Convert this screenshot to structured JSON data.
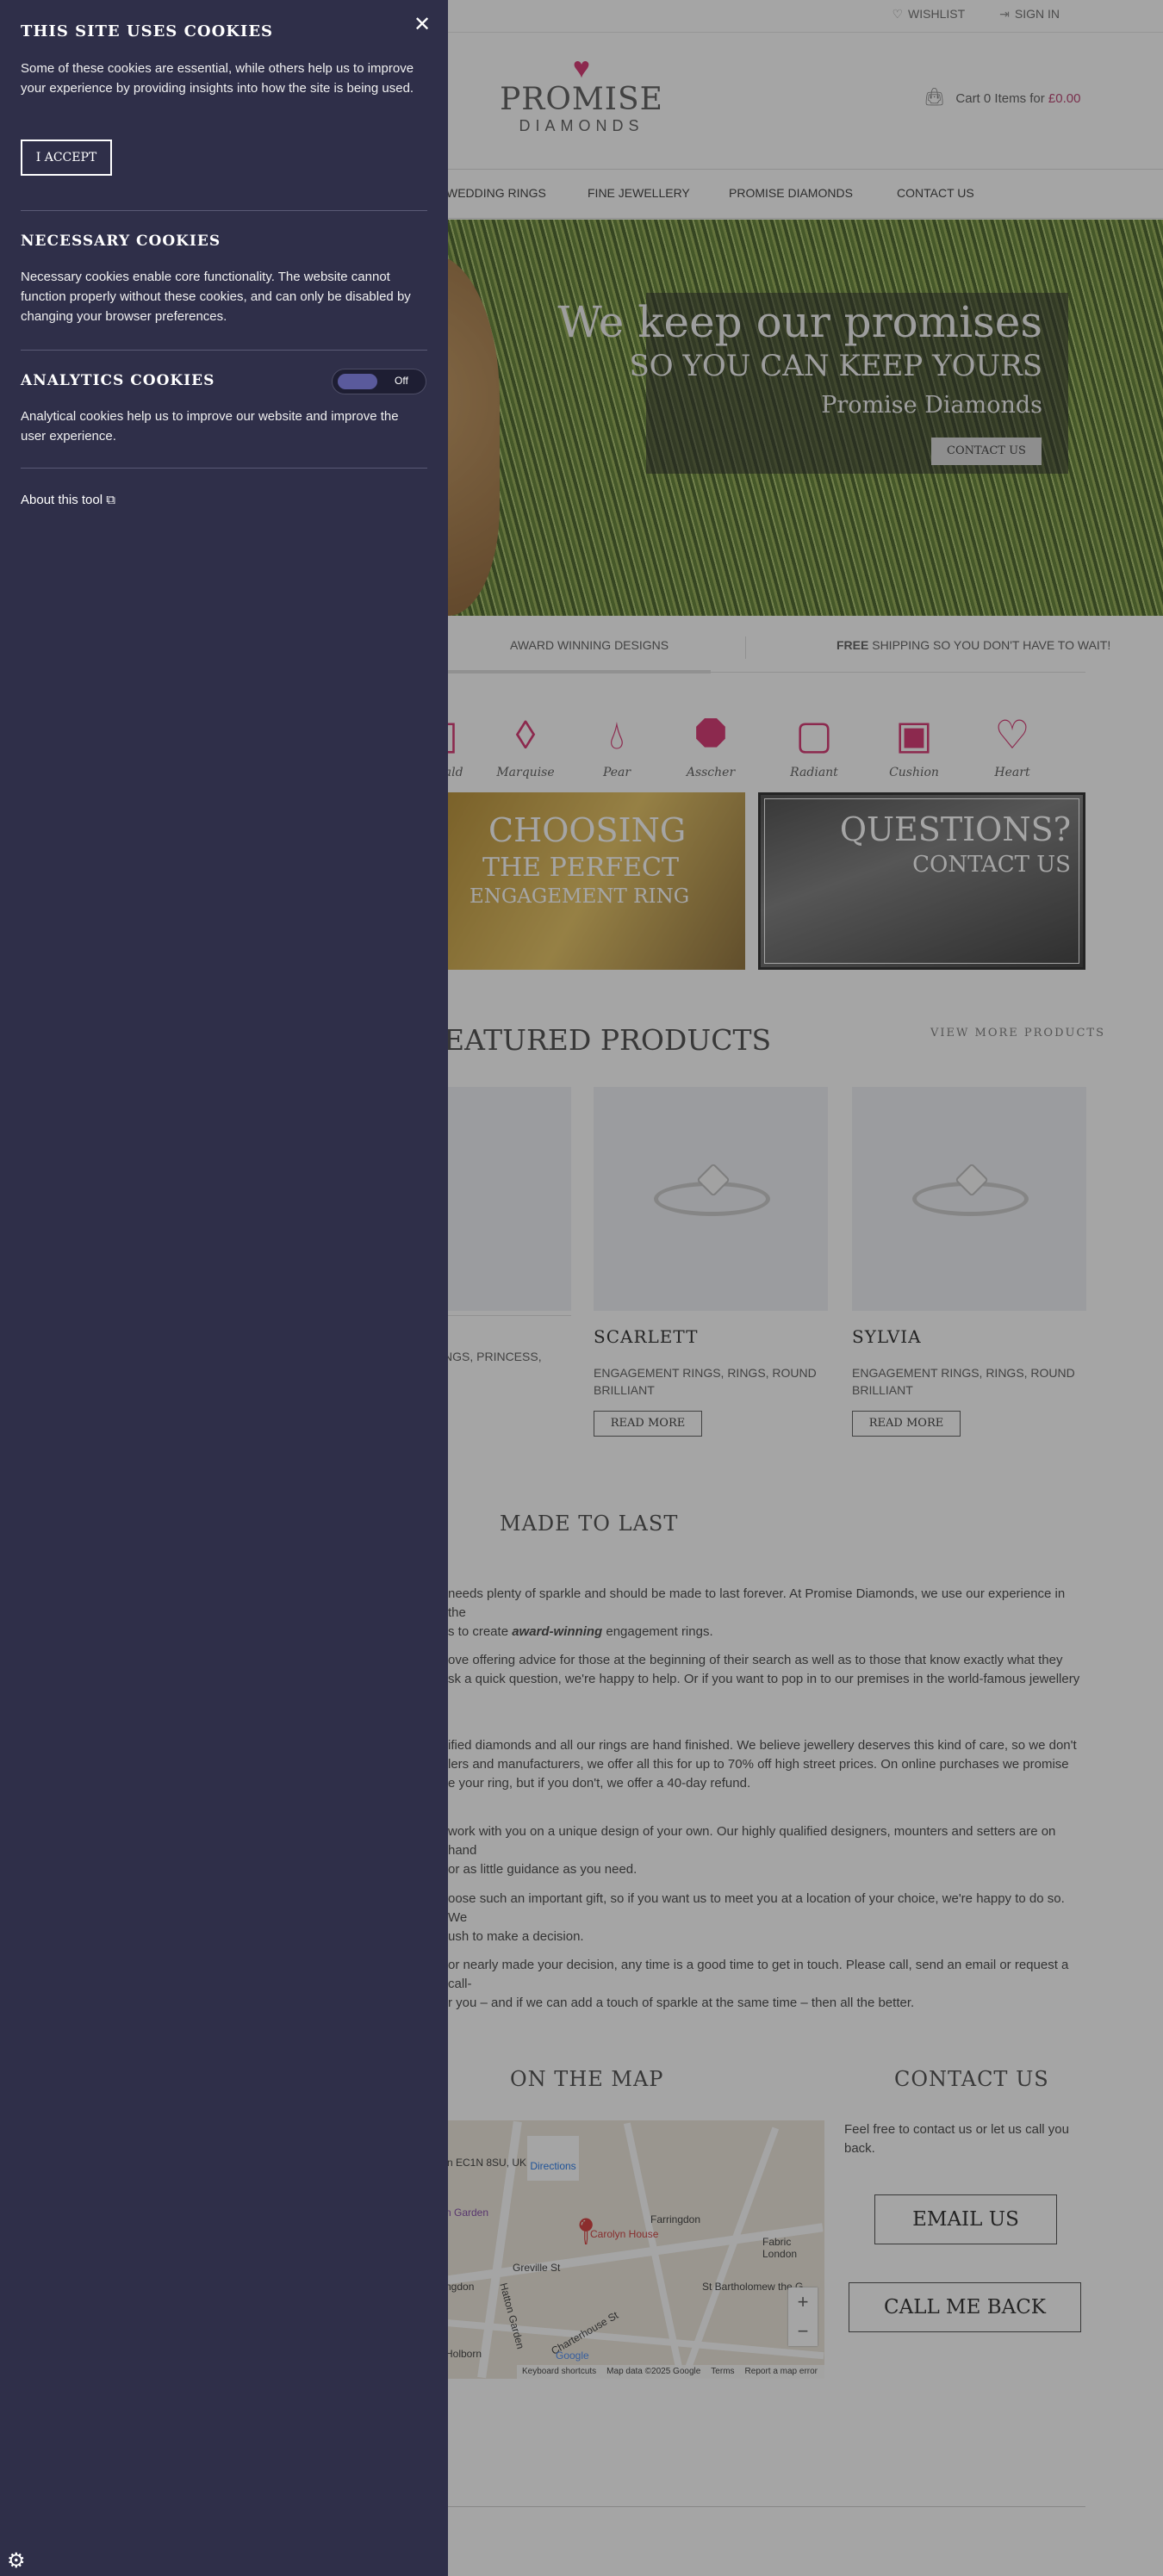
{
  "topbar": {
    "wishlist": "WISHLIST",
    "signin": "SIGN IN"
  },
  "logo": {
    "name": "PROMISE",
    "sub": "DIAMONDS"
  },
  "cart": {
    "prefix": "Cart 0 Items for ",
    "amount": "£0.00"
  },
  "nav": [
    "WEDDING RINGS",
    "FINE JEWELLERY",
    "PROMISE DIAMONDS",
    "CONTACT US"
  ],
  "hero": {
    "line1": "We keep our promises",
    "line2": "SO YOU CAN KEEP YOURS",
    "line3": "Promise Diamonds",
    "button": "CONTACT US"
  },
  "usp": {
    "award": "AWARD WINNING DESIGNS",
    "free_bold": "FREE",
    "free_rest": " SHIPPING SO YOU DON'T HAVE TO WAIT!"
  },
  "shapes": [
    "...ald",
    "Marquise",
    "Pear",
    "Asscher",
    "Radiant",
    "Cushion",
    "Heart"
  ],
  "promo": {
    "choose_a": "CHOOSING",
    "choose_b": "THE PERFECT",
    "choose_c": "ENGAGEMENT RING",
    "q_a": "QUESTIONS?",
    "q_b": "CONTACT US"
  },
  "featured": {
    "title": "EATURED PRODUCTS",
    "view_more": "VIEW MORE PRODUCTS",
    "partial_cats": "NGS, PRINCESS,",
    "products": [
      {
        "name": "SCARLETT",
        "cats": "ENGAGEMENT RINGS, RINGS, ROUND BRILLIANT",
        "button": "READ MORE"
      },
      {
        "name": "SYLVIA",
        "cats": "ENGAGEMENT RINGS, RINGS, ROUND BRILLIANT",
        "button": "READ MORE"
      }
    ]
  },
  "made_to_last": {
    "title": "MADE TO LAST",
    "p1a": "needs plenty of sparkle and should be made to last forever. At Promise Diamonds, we use our experience in the",
    "p1b": "s to create ",
    "p1em": "award-winning",
    "p1c": " engagement rings.",
    "p2": "ove offering advice for those at the beginning of their search as well as to those that know exactly what they\nsk a quick question, we're happy to help. Or if you want to pop in to our premises in the world-famous jewellery",
    "p3": "ified diamonds and all our rings are hand finished. We believe jewellery deserves this kind of care, so we don't\nlers and manufacturers, we offer all this for up to 70% off high street prices. On online purchases we promise\ne your ring, but if you don't, we offer a 40-day refund.",
    "p4": " work with you on a unique design of your own. Our highly qualified designers, mounters and setters are on hand\nor as little guidance as you need.",
    "p5": "oose such an important gift, so if you want us to meet you at a location of your choice, we're happy to do so. We\nush to make a decision.",
    "p6": "or nearly made your decision, any time is a good time to get in touch. Please call, send an email or request a call-\nr you – and if we can add a touch of sparkle at the same time – then all the better."
  },
  "map": {
    "title": "ON THE MAP",
    "address": "n EC1N 8SU, UK",
    "directions": "Directions",
    "labels": [
      "Carolyn House",
      "Farringdon",
      "Fabric London",
      "Greville St",
      "St Bartholomew the G",
      "n Garden",
      "ngdon",
      "Hatton Garden",
      "Holborn",
      "Charterhouse St",
      "Google"
    ],
    "footer": [
      "Keyboard shortcuts",
      "Map data ©2025 Google",
      "Terms",
      "Report a map error"
    ]
  },
  "contact": {
    "title": "CONTACT US",
    "text": "Feel free to contact us or let us call you back.",
    "email": "EMAIL US",
    "call": "CALL ME BACK"
  },
  "cookies": {
    "title": "THIS SITE USES COOKIES",
    "intro": "Some of these cookies are essential, while others help us to improve your experience by providing insights into how the site is being used.",
    "accept": "I ACCEPT",
    "necessary_title": "NECESSARY COOKIES",
    "necessary_text": "Necessary cookies enable core functionality. The website cannot function properly without these cookies, and can only be disabled by changing your browser preferences.",
    "analytics_title": "ANALYTICS COOKIES",
    "analytics_toggle": "Off",
    "analytics_text": "Analytical cookies help us to improve our website and improve the user experience.",
    "about": "About this tool"
  },
  "icons": {
    "close": "close-icon",
    "gear": "gear-icon",
    "cart": "bag-icon",
    "heart": "heart-icon",
    "external": "external-link-icon"
  }
}
